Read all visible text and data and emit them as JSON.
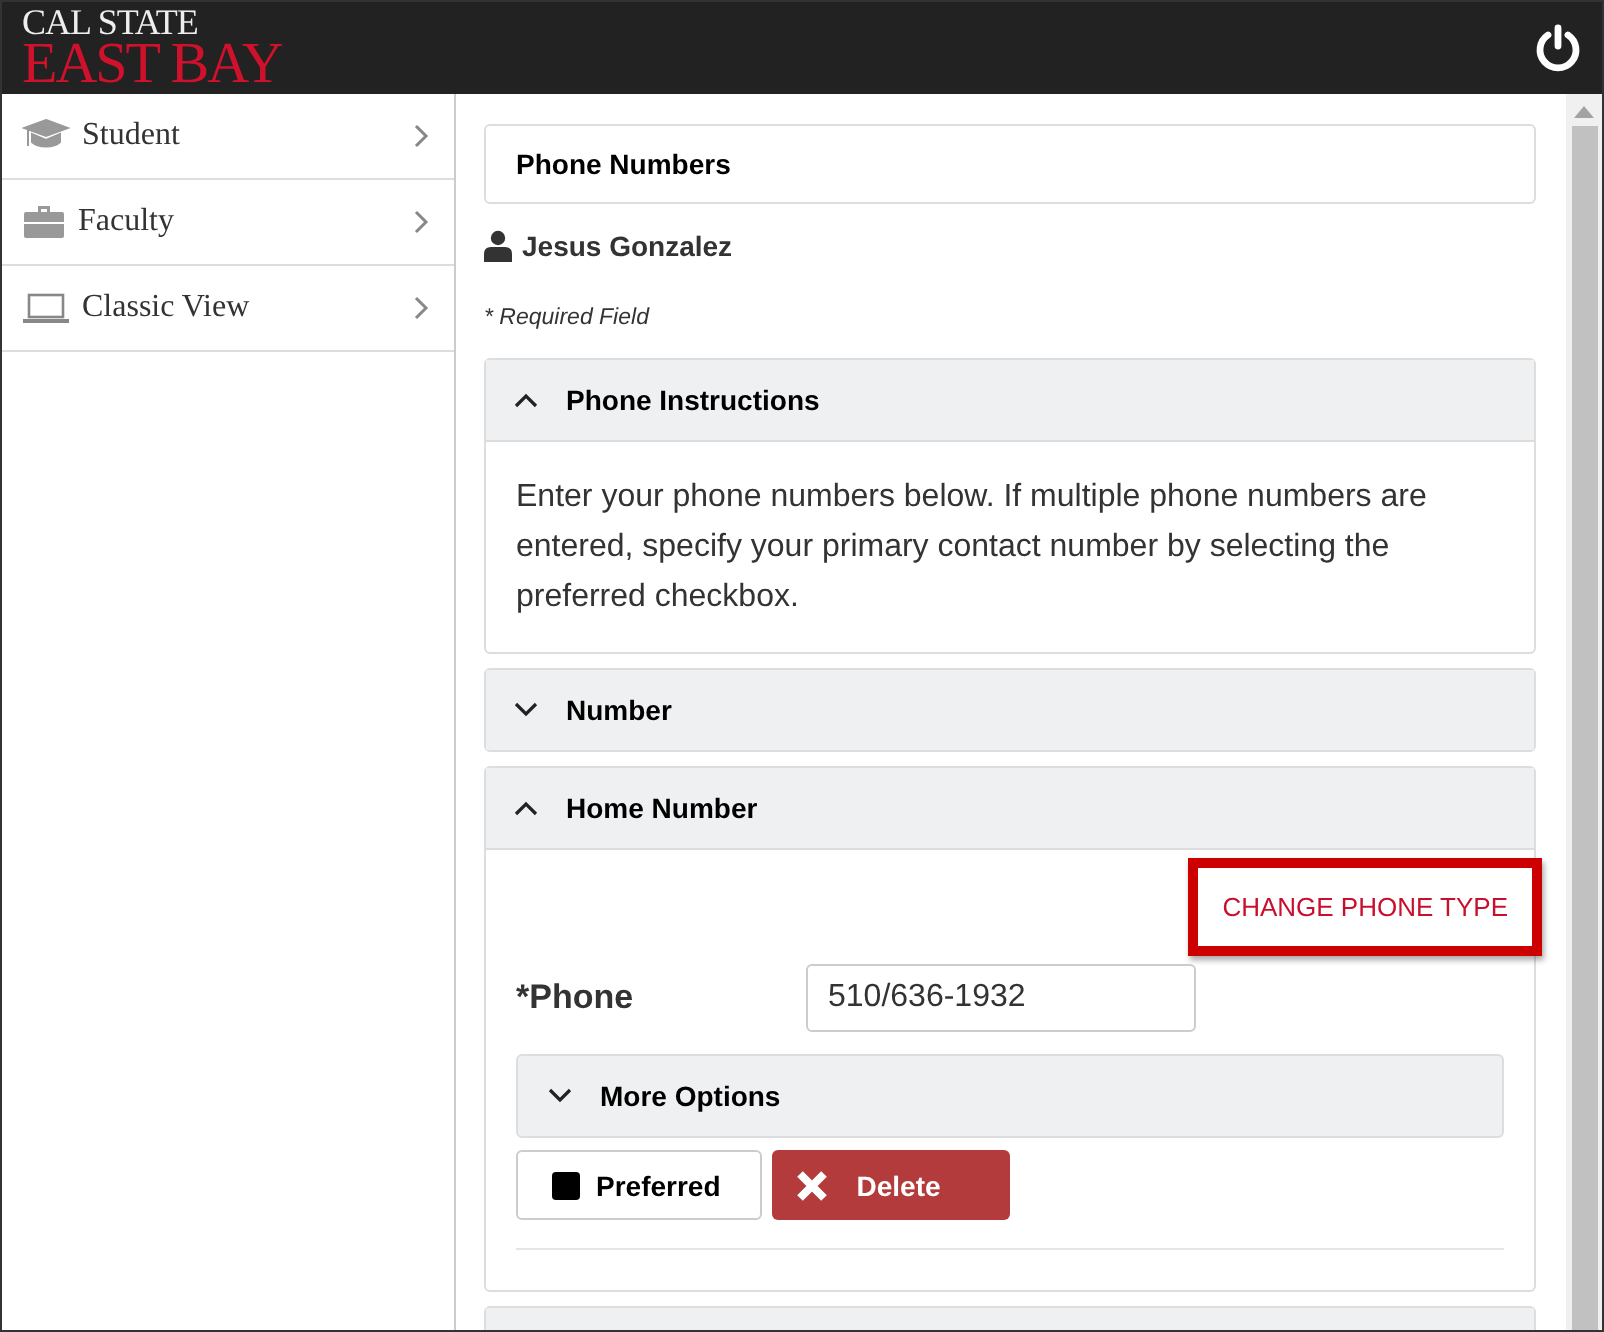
{
  "header": {
    "logo_top": "CAL STATE",
    "logo_bottom": "EAST BAY"
  },
  "sidebar": {
    "items": [
      {
        "label": "Student"
      },
      {
        "label": "Faculty"
      },
      {
        "label": "Classic View"
      }
    ]
  },
  "page_title": "Phone Numbers",
  "user_name": "Jesus Gonzalez",
  "required_note": "* Required Field",
  "sections": [
    {
      "kind": "text",
      "title": "Phone Instructions",
      "expanded": true,
      "body": "Enter your phone numbers below. If multiple phone numbers are entered, specify your primary contact number by selecting the preferred checkbox."
    },
    {
      "title": "Number",
      "expanded": false
    },
    {
      "kind": "phone",
      "title": "Home Number",
      "expanded": true,
      "change_link": "CHANGE PHONE TYPE",
      "label": "*Phone",
      "value": "510/636-1932",
      "more_options": {
        "title": "More Options",
        "expanded": false
      },
      "preferred": {
        "label": "Preferred",
        "checked": false
      },
      "delete_label": "Delete"
    },
    {
      "expanded": false
    }
  ]
}
